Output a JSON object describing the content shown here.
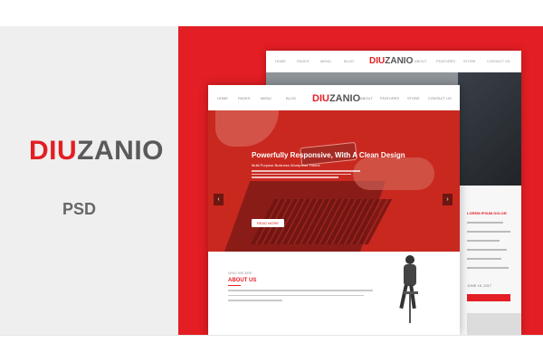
{
  "brand": {
    "part1": "DIU",
    "part2": "ZANIO"
  },
  "subtitle": "PSD",
  "colors": {
    "accent": "#e31e24",
    "panel": "#efefef"
  },
  "front": {
    "nav": [
      "HOME",
      "PAGES",
      "MENU",
      "BLOG",
      "ABOUT",
      "FEATURES",
      "STORE",
      "CONTACT US"
    ],
    "logo": {
      "part1": "DIU",
      "part2": "ZANIO"
    },
    "hero": {
      "title": "Powerfully Responsive, With A Clean Design",
      "subtitle": "Multi Purpose Business Wordpress Theme",
      "button": "READ MORE",
      "prev_icon": "‹",
      "next_icon": "›"
    },
    "about": {
      "small": "WHO WE ARE",
      "title": "ABOUT US"
    }
  },
  "back": {
    "nav": [
      "HOME",
      "PAGES",
      "MENU",
      "BLOG",
      "ABOUT",
      "FEATURES",
      "STORE",
      "CONTACT US"
    ],
    "logo": {
      "part1": "DIU",
      "part2": "ZANIO"
    },
    "sidebar": {
      "title": "LOREM IPSUM DOLOR",
      "date": "JUNE 15, 2017"
    }
  }
}
